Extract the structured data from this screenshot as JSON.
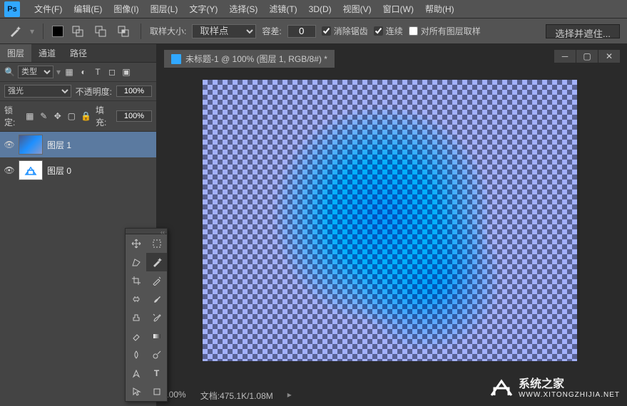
{
  "menu": {
    "items": [
      "文件(F)",
      "编辑(E)",
      "图像(I)",
      "图层(L)",
      "文字(Y)",
      "选择(S)",
      "滤镜(T)",
      "3D(D)",
      "视图(V)",
      "窗口(W)",
      "帮助(H)"
    ]
  },
  "options": {
    "sample_label": "取样大小:",
    "sample_value": "取样点",
    "tolerance_label": "容差:",
    "tolerance_value": "0",
    "antialias": "消除锯齿",
    "contiguous": "连续",
    "all_layers": "对所有图层取样",
    "select_mask_btn": "选择并遮住..."
  },
  "panel": {
    "tabs": [
      "图层",
      "通道",
      "路径"
    ],
    "kind_label": "类型",
    "blend_mode": "强光",
    "opacity_label": "不透明度:",
    "opacity_value": "100%",
    "lock_label": "锁定:",
    "fill_label": "填充:",
    "fill_value": "100%",
    "layers": [
      {
        "name": "图层 1",
        "selected": true,
        "visible": true
      },
      {
        "name": "图层 0",
        "selected": false,
        "visible": true
      }
    ]
  },
  "document": {
    "title": "未标题-1 @ 100% (图层 1, RGB/8#) *"
  },
  "status": {
    "zoom": "100%",
    "doc_info": "文档:475.1K/1.08M"
  },
  "watermark": {
    "title": "系统之家",
    "url": "WWW.XITONGZHIJIA.NET"
  },
  "icons": {
    "ps": "Ps"
  }
}
